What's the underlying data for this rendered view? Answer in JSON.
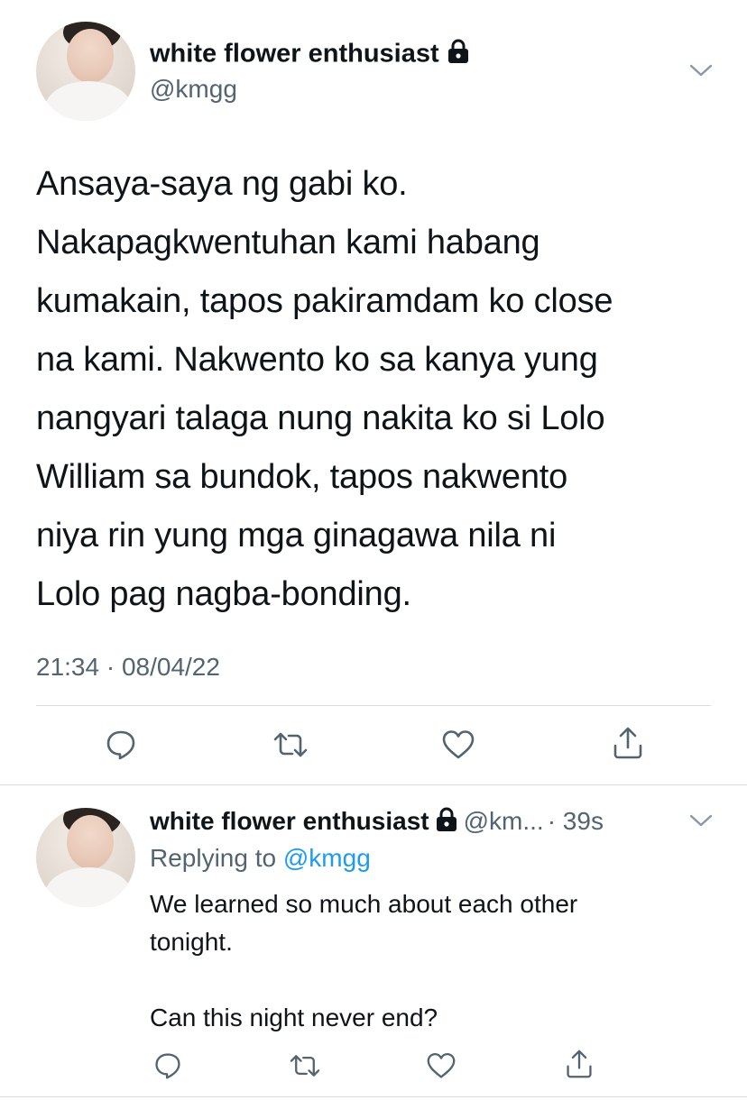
{
  "main_tweet": {
    "author": {
      "display_name": "white flower enthusiast",
      "handle": "@kmgg",
      "protected_icon": "lock-icon"
    },
    "text_lines": [
      "Ansaya-saya ng gabi ko.",
      "Nakapagkwentuhan kami habang",
      "kumakain, tapos pakiramdam ko close",
      "na kami. Nakwento ko sa kanya yung",
      "nangyari talaga nung nakita ko si Lolo",
      "William sa bundok, tapos nakwento",
      "niya rin yung mga ginagawa nila ni",
      "Lolo pag nagba-bonding."
    ],
    "timestamp": "21:34 · 08/04/22",
    "actions": {
      "reply_icon": "comment-icon",
      "retweet_icon": "retweet-icon",
      "like_icon": "heart-icon",
      "share_icon": "share-icon"
    }
  },
  "reply_tweet": {
    "author": {
      "display_name": "white flower enthusiast",
      "handle_truncated": "@km...",
      "protected_icon": "lock-icon"
    },
    "time_ago": "· 39s",
    "replying_prefix": "Replying to",
    "replying_to": "@kmgg",
    "text_line_1": "We learned so much about each other",
    "text_line_2": "tonight.",
    "text_line_3": "Can this night never end?"
  },
  "colors": {
    "text_primary": "#0f1419",
    "text_secondary": "#536471",
    "link": "#1d9bf0",
    "divider": "#d9dde0"
  }
}
